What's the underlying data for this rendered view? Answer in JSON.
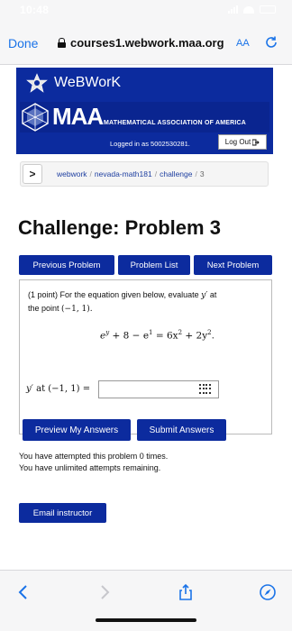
{
  "status_bar": {
    "time": "10:48"
  },
  "browser": {
    "done_label": "Done",
    "url": "courses1.webwork.maa.org",
    "aa_label": "AA"
  },
  "banner": {
    "webwork_title": "WeBWorK",
    "maa_letters": "MAA",
    "maa_full": "MATHEMATICAL ASSOCIATION OF AMERICA",
    "logged_in": "Logged in as 5002530281.",
    "logout_label": "Log Out"
  },
  "breadcrumb": {
    "toggle": ">",
    "items": [
      "webwork",
      "nevada-math181",
      "challenge",
      "3"
    ],
    "separator": "/"
  },
  "page_title": "Challenge: Problem 3",
  "nav": {
    "previous": "Previous Problem",
    "list": "Problem List",
    "next": "Next Problem"
  },
  "problem": {
    "points": "(1 point)",
    "text_a": "For the equation given below, evaluate",
    "yprime": "y′",
    "text_b": "at",
    "text_c": "the point",
    "point": "(−1, 1).",
    "equation_lhs": "e",
    "lhs_exp": "y",
    "equation_mid": " + 8 − e",
    "mid_exp": "1",
    "equation_eq": " = 6x",
    "x_exp": "2",
    "equation_plus": " + 2y",
    "y_exp": "2",
    "equation_end": ".",
    "answer_label_var": "y′",
    "answer_label_rest": " at (−1, 1) =",
    "answer_value": "",
    "answer_placeholder": ""
  },
  "actions": {
    "preview": "Preview My Answers",
    "submit": "Submit Answers"
  },
  "attempts": {
    "line1": "You have attempted this problem 0 times.",
    "line2": "You have unlimited attempts remaining."
  },
  "email_label": "Email instructor",
  "colors": {
    "brand_blue": "#0c2b9e",
    "link_blue": "#1a73e8"
  }
}
